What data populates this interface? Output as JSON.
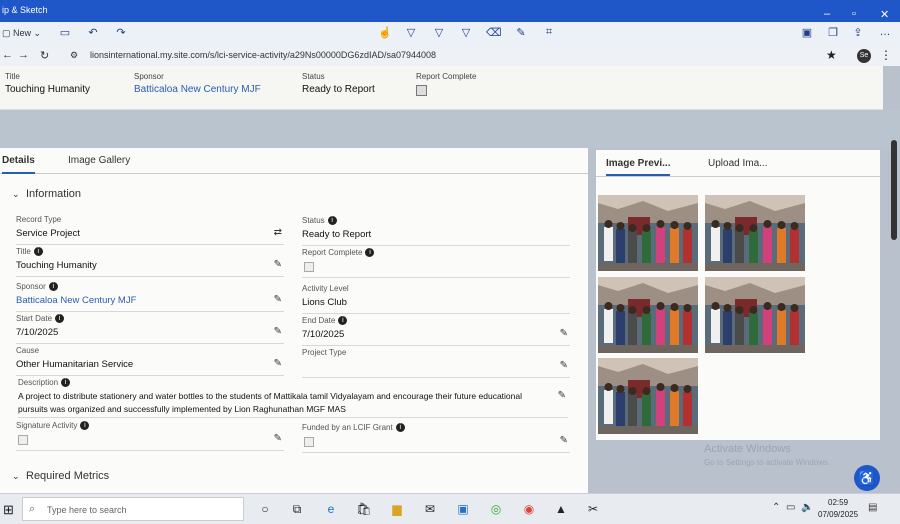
{
  "app": {
    "title": "ip & Sketch",
    "new_label": "New"
  },
  "browser": {
    "url": "lionsinternational.my.site.com/s/lci-service-activity/a29Ns00000DG6zdIAD/sa07944008",
    "profile_initials": "Se"
  },
  "highlights": [
    {
      "label": "Title",
      "value": "Touching Humanity",
      "link": false
    },
    {
      "label": "Sponsor",
      "value": "Batticaloa New Century MJF",
      "link": true
    },
    {
      "label": "Status",
      "value": "Ready to Report",
      "link": false
    },
    {
      "label": "Report Complete",
      "value": "",
      "link": false
    }
  ],
  "tabs": {
    "details": "Details",
    "gallery": "Image Gallery"
  },
  "section": {
    "information": "Information",
    "required_metrics": "Required Metrics"
  },
  "fields": {
    "record_type": {
      "label": "Record Type",
      "value": "Service Project"
    },
    "status": {
      "label": "Status",
      "value": "Ready to Report"
    },
    "title": {
      "label": "Title",
      "value": "Touching Humanity"
    },
    "report_complete": {
      "label": "Report Complete"
    },
    "sponsor": {
      "label": "Sponsor",
      "value": "Batticaloa New Century MJF"
    },
    "activity_level": {
      "label": "Activity Level",
      "value": "Lions Club"
    },
    "start_date": {
      "label": "Start Date",
      "value": "7/10/2025"
    },
    "end_date": {
      "label": "End Date",
      "value": "7/10/2025"
    },
    "cause": {
      "label": "Cause",
      "value": "Other Humanitarian Service"
    },
    "project_type": {
      "label": "Project Type",
      "value": ""
    },
    "description": {
      "label": "Description",
      "value": "A project to distribute stationery and water bottles to the students of Mattikala tamil Vidyalayam and encourage their future educational pursuits was organized and successfully implemented by Lion Raghunathan MGF MAS"
    },
    "signature_activity": {
      "label": "Signature Activity"
    },
    "lcif_grant": {
      "label": "Funded by an LCIF Grant"
    }
  },
  "side_panel": {
    "tab_preview": "Image Previ...",
    "tab_upload": "Upload Ima..."
  },
  "watermark": {
    "line1": "Activate Windows",
    "line2": "Go to Settings to activate Windows."
  },
  "taskbar": {
    "search_placeholder": "Type here to search",
    "time": "02:59",
    "date": "07/09/2025"
  }
}
